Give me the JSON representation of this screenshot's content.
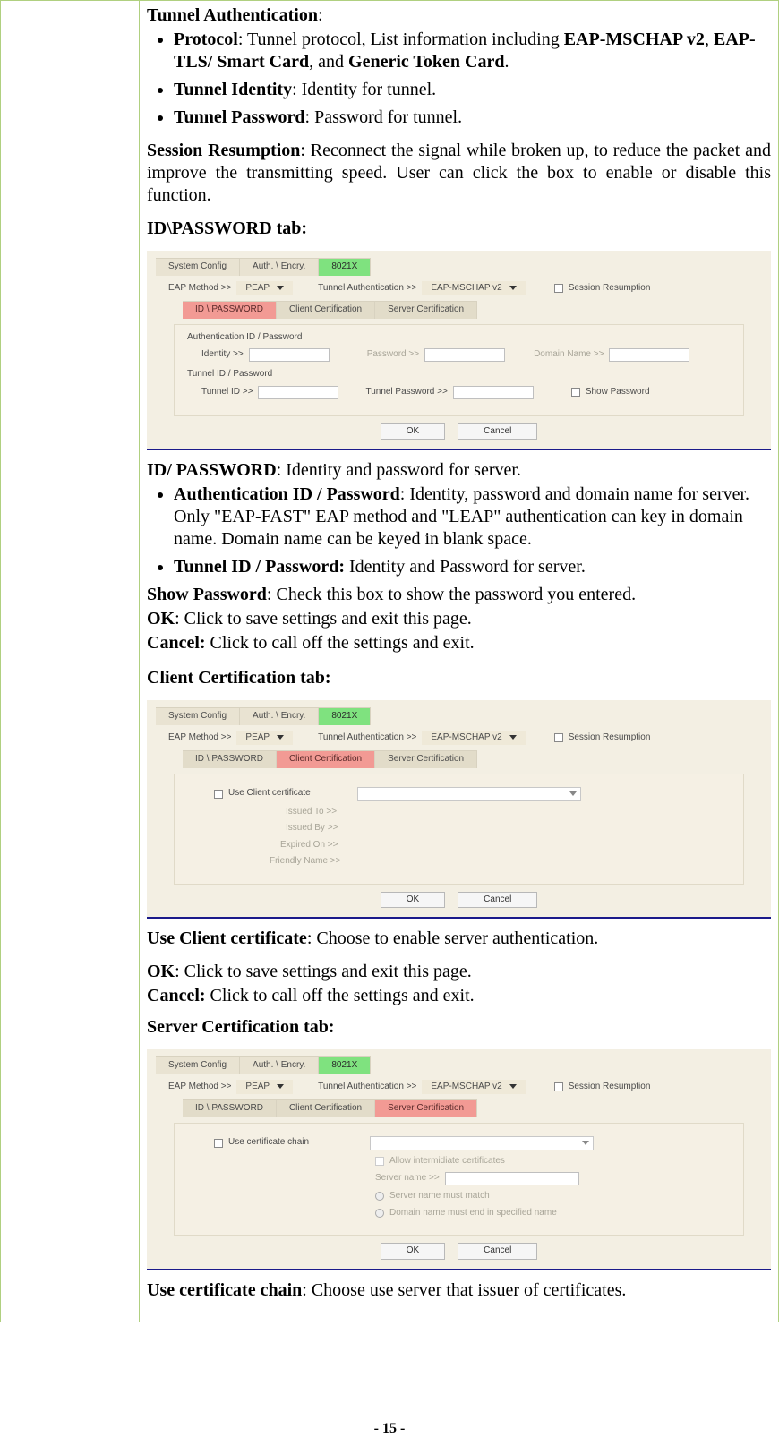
{
  "doc": {
    "tunnelAuth": {
      "heading": "Tunnel Authentication",
      "protocol": {
        "label": "Protocol",
        "text1": ": Tunnel protocol, List information including ",
        "eapmschap": "EAP-MSCHAP v2",
        "sep1": ", ",
        "eaptls": "EAP-TLS/ Smart Card",
        "sep2": ", and ",
        "generic": "Generic Token Card",
        "tail": "."
      },
      "tunnelIdentity": {
        "label": "Tunnel Identity",
        "text": ": Identity for tunnel."
      },
      "tunnelPassword": {
        "label": "Tunnel Password",
        "text": ": Password for tunnel."
      }
    },
    "sessionResumption": {
      "label": "Session Resumption",
      "text": ": Reconnect the signal while broken up, to reduce the packet and improve the transmitting speed. User can click the box to enable or disable this function."
    },
    "idPwdTabHeading": "ID\\PASSWORD tab:",
    "idPwd": {
      "heading": "ID/ PASSWORD",
      "headingText": ": Identity and password for server.",
      "authId": {
        "label": "Authentication ID / Password",
        "text": ": Identity, password and domain name for server. Only \"EAP-FAST\" EAP method and \"LEAP\" authentication can key in domain name. Domain name can be keyed in blank space."
      },
      "tunnelId": {
        "label": "Tunnel ID / Password:",
        "text": " Identity and Password for server."
      }
    },
    "showPwd": {
      "label": "Show Password",
      "text": ": Check this box to show the password you entered."
    },
    "ok": {
      "label": "OK",
      "text": ": Click to save settings and exit this page."
    },
    "cancel": {
      "label": "Cancel:",
      "text": " Click to call off the settings and exit."
    },
    "clientCertHeading": "Client Certification tab:",
    "useClientCert": {
      "label": "Use Client certificate",
      "text": ": Choose to enable server authentication."
    },
    "ok2": {
      "label": "OK",
      "text": ": Click to save settings and exit this page."
    },
    "cancel2": {
      "label": "Cancel:",
      "text": " Click to call off the settings and exit."
    },
    "serverCertHeading": "Server Certification tab:",
    "useCertChain": {
      "label": "Use certificate chain",
      "text": ": Choose use server that issuer of certificates."
    },
    "pageNum": "- 15 -"
  },
  "ss": {
    "topTabs": {
      "sys": "System Config",
      "auth": "Auth. \\ Encry.",
      "x": "8021X"
    },
    "eapLabel": "EAP Method >>",
    "eapValue": "PEAP",
    "taLabel": "Tunnel Authentication >>",
    "taValue": "EAP-MSCHAP v2",
    "sessionResumption": "Session Resumption",
    "subtabs": {
      "idpwd": "ID \\ PASSWORD",
      "cc": "Client Certification",
      "sc": "Server Certification"
    },
    "authIdHeading": "Authentication ID / Password",
    "identityLabel": "Identity >>",
    "passwordLabel": "Password >>",
    "domainLabel": "Domain Name >>",
    "tunnelIdHeading": "Tunnel ID / Password",
    "tunnelIdLabel": "Tunnel ID >>",
    "tunnelPwLabel": "Tunnel Password >>",
    "showPwd": "Show Password",
    "okBtn": "OK",
    "cancelBtn": "Cancel",
    "useClientCert": "Use Client certificate",
    "issuedTo": "Issued To >>",
    "issuedBy": "Issued By >>",
    "expiredOn": "Expired On >>",
    "friendlyName": "Friendly Name >>",
    "useCertChain": "Use certificate chain",
    "allowIntermediate": "Allow intermidiate certificates",
    "serverNameLabel": "Server name >>",
    "opt1": "Server name must match",
    "opt2": "Domain name must end in specified name"
  }
}
